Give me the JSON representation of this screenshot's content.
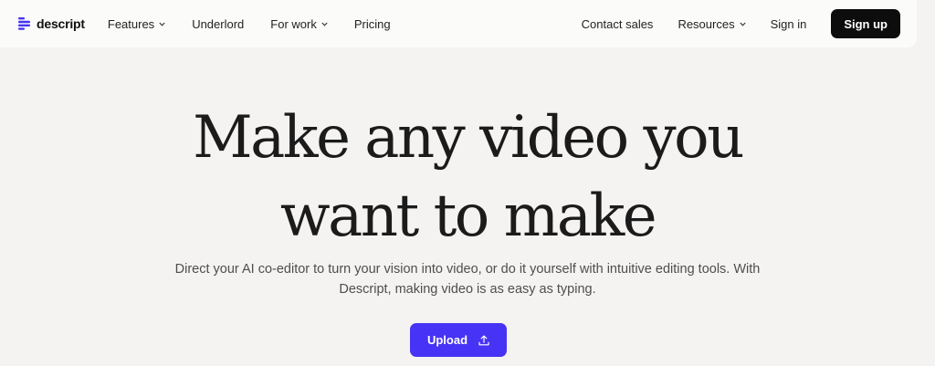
{
  "brand": {
    "name": "descript",
    "accent": "#4733f5"
  },
  "nav": {
    "left": [
      {
        "label": "Features",
        "dropdown": true
      },
      {
        "label": "Underlord",
        "dropdown": false
      },
      {
        "label": "For work",
        "dropdown": true
      },
      {
        "label": "Pricing",
        "dropdown": false
      }
    ],
    "right": [
      {
        "label": "Contact sales",
        "dropdown": false
      },
      {
        "label": "Resources",
        "dropdown": true
      },
      {
        "label": "Sign in",
        "dropdown": false
      }
    ],
    "signup_label": "Sign up"
  },
  "hero": {
    "headline_line1": "Make any video you",
    "headline_line2": "want to make",
    "subtext": "Direct your AI co-editor to turn your vision into video, or do it yourself with intuitive editing tools. With Descript, making video is as easy as typing.",
    "upload_label": "Upload",
    "upload_icon": "upload-icon"
  }
}
